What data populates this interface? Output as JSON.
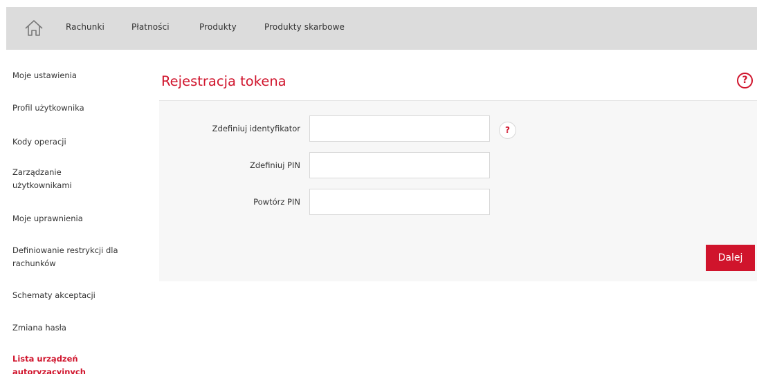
{
  "colors": {
    "accent": "#d0142c",
    "nav_bg": "#dcdcdc",
    "panel_bg": "#f7f7f7"
  },
  "topnav": {
    "home_icon": "home-icon",
    "items": [
      "Rachunki",
      "Płatności",
      "Produkty",
      "Produkty skarbowe"
    ]
  },
  "sidebar": {
    "items": [
      {
        "label": "Moje ustawienia"
      },
      {
        "label": "Profil użytkownika"
      },
      {
        "label": "Kody operacji"
      },
      {
        "label": "Zarządzanie użytkownikami"
      },
      {
        "label": "Moje uprawnienia"
      },
      {
        "label": "Definiowanie restrykcji dla rachunków"
      },
      {
        "label": "Schematy akceptacji"
      },
      {
        "label": "Zmiana hasła"
      },
      {
        "label": "Lista urządzeń autoryzacyjnych"
      }
    ],
    "active_index": 8
  },
  "panel": {
    "title": "Rejestracja tokena",
    "help_icon": "question-icon",
    "help_glyph": "?",
    "fields": [
      {
        "label": "Zdefiniuj identyfikator",
        "value": "",
        "placeholder": ""
      },
      {
        "label": "Zdefiniuj PIN",
        "value": "",
        "placeholder": ""
      },
      {
        "label": "Powtórz PIN",
        "value": "",
        "placeholder": ""
      }
    ],
    "field_help_glyph": "?",
    "next_label": "Dalej"
  }
}
